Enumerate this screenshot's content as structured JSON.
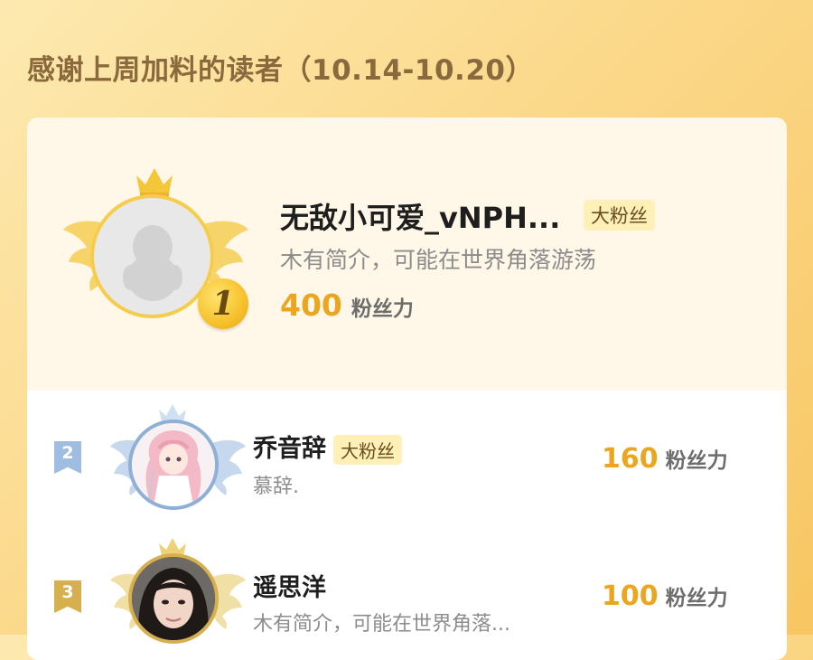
{
  "header": {
    "title": "感谢上周加料的读者（10.14-10.20）"
  },
  "colors": {
    "accent_orange": "#eba51f",
    "gold": "#f6cd4b",
    "silver": "#8fb0d6",
    "bronze": "#d6b04e"
  },
  "ranking": [
    {
      "rank": "1",
      "name": "无敌小可爱_vNPH...",
      "tag": "大粉丝",
      "bio": "木有简介，可能在世界角落游荡",
      "score": "400",
      "unit": "粉丝力",
      "avatar_icon": "default-penguin-avatar-icon"
    },
    {
      "rank": "2",
      "name": "乔音辞",
      "tag": "大粉丝",
      "bio": "慕辞.",
      "score": "160",
      "unit": "粉丝力",
      "avatar_icon": "anime-girl-avatar"
    },
    {
      "rank": "3",
      "name": "遥思洋",
      "tag": "",
      "bio": "木有简介，可能在世界角落...",
      "score": "100",
      "unit": "粉丝力",
      "avatar_icon": "photo-avatar"
    }
  ]
}
